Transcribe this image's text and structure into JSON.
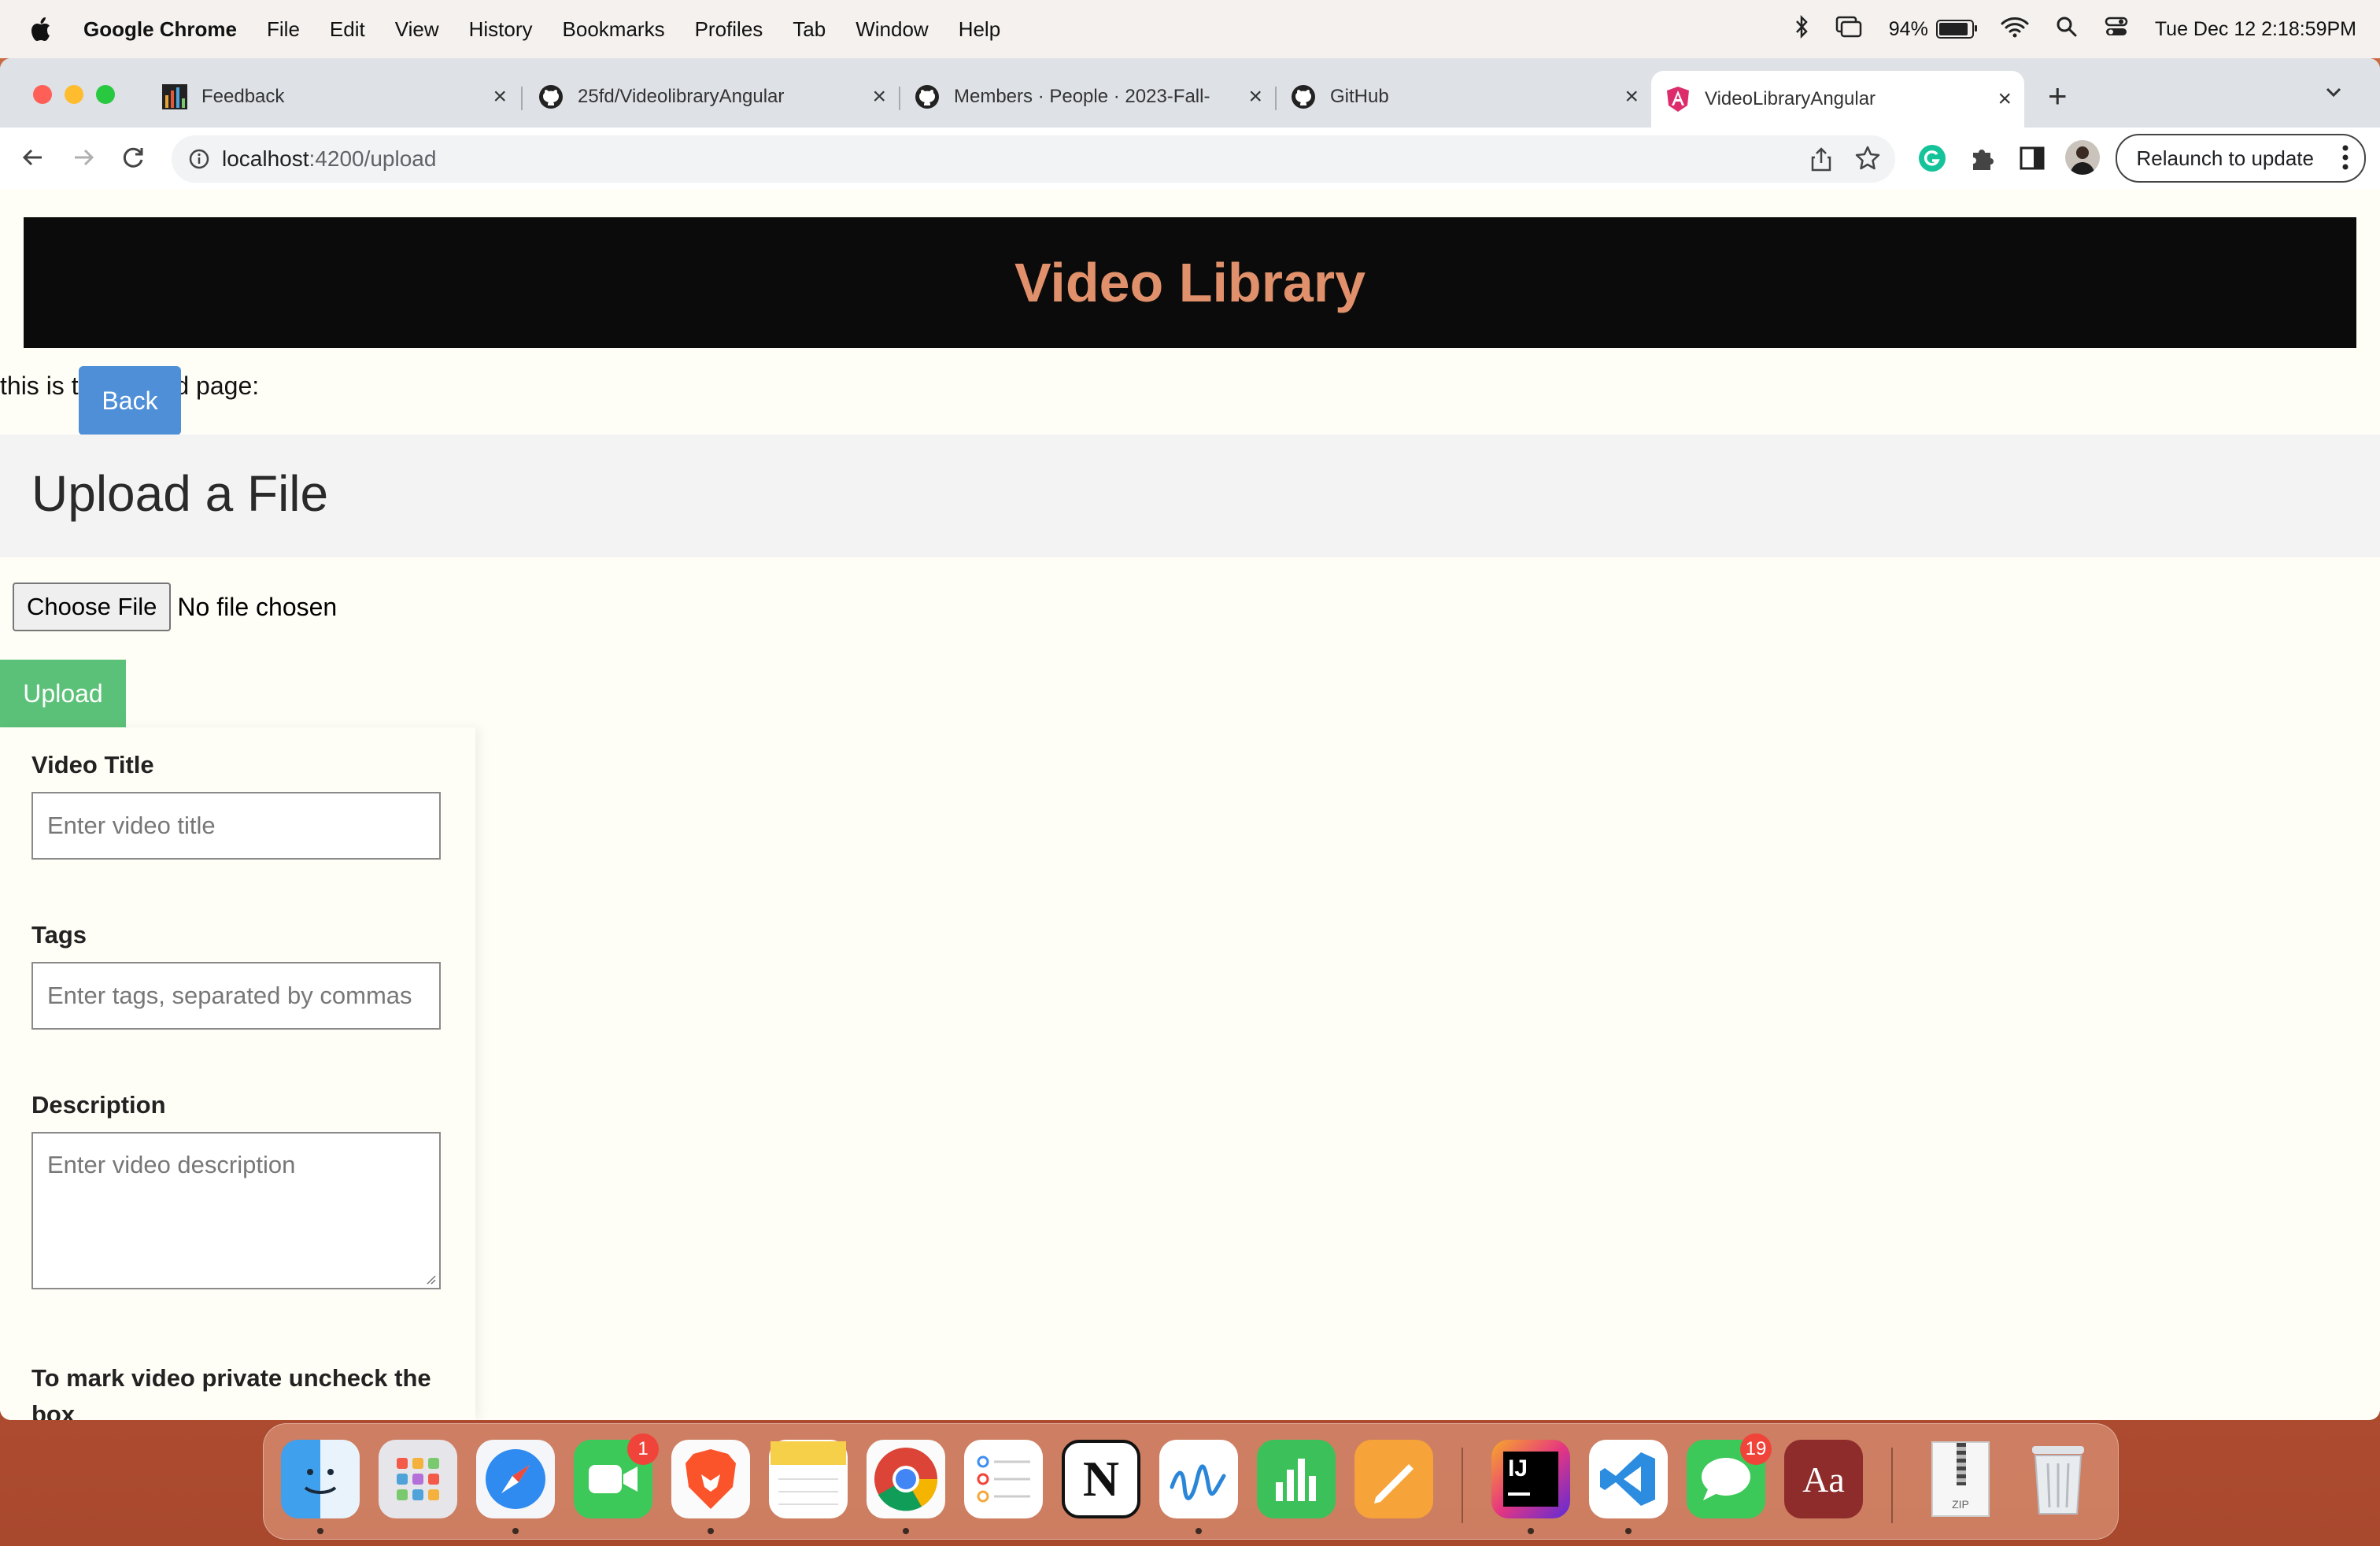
{
  "menubar": {
    "app_name": "Google Chrome",
    "items": [
      "File",
      "Edit",
      "View",
      "History",
      "Bookmarks",
      "Profiles",
      "Tab",
      "Window",
      "Help"
    ],
    "battery_percent": "94%",
    "datetime": "Tue Dec 12  2:18:59PM"
  },
  "tabs": [
    {
      "title": "Feedback",
      "icon": "bar-chart-favicon"
    },
    {
      "title": "25fd/VideolibraryAngular",
      "icon": "github-favicon"
    },
    {
      "title": "Members · People · 2023-Fall-",
      "icon": "github-favicon"
    },
    {
      "title": "GitHub",
      "icon": "github-favicon"
    },
    {
      "title": "VideoLibraryAngular",
      "icon": "angular-favicon",
      "active": true
    }
  ],
  "toolbar": {
    "url_host": "localhost",
    "url_path": ":4200/upload",
    "relaunch_label": "Relaunch to update"
  },
  "page": {
    "header_title": "Video Library",
    "intro_text": "this is the upload page:",
    "back_label": "Back",
    "upload_heading": "Upload a File",
    "choose_file_label": "Choose File",
    "no_file_text": "No file chosen",
    "upload_label": "Upload",
    "form": {
      "title_label": "Video Title",
      "title_placeholder": "Enter video title",
      "tags_label": "Tags",
      "tags_placeholder": "Enter tags, separated by commas",
      "description_label": "Description",
      "description_placeholder": "Enter video description",
      "private_label": "To mark video private uncheck the box"
    }
  },
  "dock": {
    "apps": [
      "Finder",
      "Launchpad",
      "Safari",
      "FaceTime",
      "Brave",
      "Notes",
      "Chrome",
      "Reminders",
      "Notion",
      "Freeform",
      "Numbers",
      "Pages",
      "IntelliJ IDEA",
      "VS Code",
      "Messages",
      "Dictionary",
      "Archive Utility",
      "Trash"
    ],
    "facetime_badge": "1",
    "messages_badge": "19",
    "intellij_text": "IJ",
    "dictionary_text": "Aa",
    "notion_text": "N",
    "archive_text": "ZIP"
  },
  "colors": {
    "header_bg": "#0b0b0b",
    "header_text": "#e0906a",
    "back_button": "#4f8fd8",
    "upload_button": "#5cc178",
    "page_bg": "#fffef6"
  }
}
